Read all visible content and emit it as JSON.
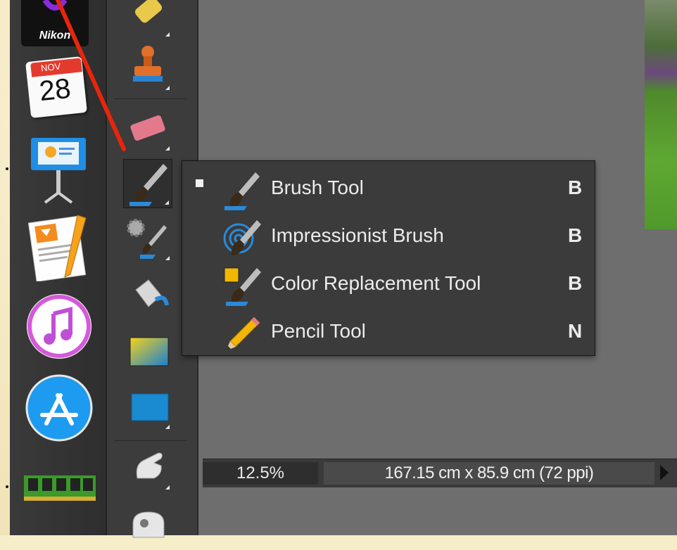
{
  "dock": {
    "nikon_label": "Nikon",
    "calendar_month": "NOV",
    "calendar_day": "28"
  },
  "flyout": {
    "items": [
      {
        "label": "Brush Tool",
        "shortcut": "B",
        "selected": true,
        "icon": "brush-icon"
      },
      {
        "label": "Impressionist Brush",
        "shortcut": "B",
        "selected": false,
        "icon": "impressionist-brush-icon"
      },
      {
        "label": "Color Replacement Tool",
        "shortcut": "B",
        "selected": false,
        "icon": "color-replacement-icon"
      },
      {
        "label": "Pencil Tool",
        "shortcut": "N",
        "selected": false,
        "icon": "pencil-icon"
      }
    ]
  },
  "status": {
    "zoom": "12.5%",
    "doc_size": "167.15 cm x 85.9 cm (72 ppi)"
  },
  "colors": {
    "toolbox_bg": "#3c3c3c",
    "menu_bg": "#3b3b3b",
    "canvas_bg": "#6e6e6e",
    "pointer_red": "#e8250c"
  }
}
